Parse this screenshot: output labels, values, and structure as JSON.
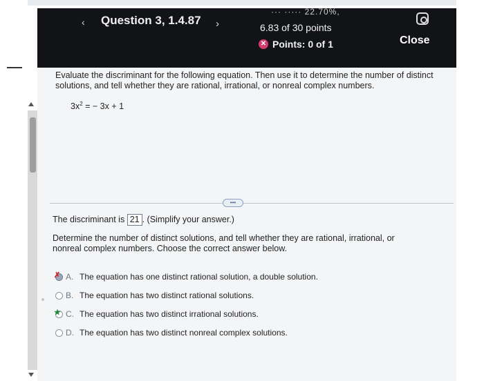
{
  "header": {
    "back_symbol": "‹",
    "question_title": "Question 3, 1.4.87",
    "next_symbol": "›",
    "score_partial": "··· ····· 22.70%,",
    "points_total": "6.83 of 30 points",
    "points_status_icon": "x-circle-icon",
    "points_score": "Points: 0 of 1",
    "settings_icon": "settings-icon",
    "close_label": "Close"
  },
  "question": {
    "prompt": "Evaluate the discriminant for the following equation. Then use it to determine the number of distinct solutions, and tell whether they are rational, irrational, or nonreal complex numbers.",
    "equation_base": "3x",
    "equation_exponent": "2",
    "equation_rest": " = − 3x + 1"
  },
  "more_label": "•••",
  "discriminant": {
    "prefix": "The discriminant is",
    "value": "21",
    "suffix": ". (Simplify your answer.)"
  },
  "instruction": "Determine the number of distinct solutions, and tell whether they are rational, irrational, or nonreal complex numbers. Choose the correct answer below.",
  "options": [
    {
      "letter": "A.",
      "text": "The equation has one distinct rational solution, a double solution.",
      "state": "selected-incorrect",
      "mark": "✗"
    },
    {
      "letter": "B.",
      "text": "The equation has two distinct rational solutions.",
      "state": "none",
      "mark": ""
    },
    {
      "letter": "C.",
      "text": "The equation has two distinct irrational solutions.",
      "state": "correct",
      "mark": "★"
    },
    {
      "letter": "D.",
      "text": "The equation has two distinct nonreal complex solutions.",
      "state": "none",
      "mark": ""
    }
  ],
  "colors": {
    "header_bg": "#111317",
    "incorrect_mark": "#cc2a2a",
    "correct_mark": "#1f8a38",
    "status_icon": "#d23b6c"
  }
}
